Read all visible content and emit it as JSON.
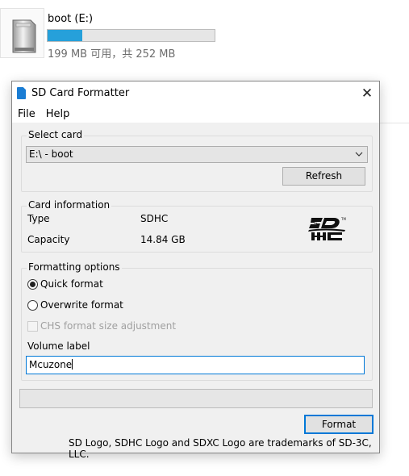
{
  "drive": {
    "name": "boot (E:)",
    "size_text": "199 MB 可用，共 252 MB",
    "used_fraction": 0.21,
    "icon": "drive-icon",
    "bar_color": "#26a0da"
  },
  "window": {
    "title": "SD Card Formatter",
    "close_glyph": "✕",
    "accent": "#0078d7"
  },
  "menu": [
    "File",
    "Help"
  ],
  "select_card": {
    "title": "Select card",
    "selected": "E:\\ - boot",
    "refresh_label": "Refresh"
  },
  "card_info": {
    "title": "Card information",
    "type_label": "Type",
    "type_value": "SDHC",
    "capacity_label": "Capacity",
    "capacity_value": "14.84 GB",
    "logo": "sdhc-logo"
  },
  "formatting": {
    "title": "Formatting options",
    "quick_label": "Quick format",
    "overwrite_label": "Overwrite format",
    "chs_label": "CHS format size adjustment",
    "selected_option": "quick",
    "volume_label_title": "Volume label",
    "volume_label_value": "Mcuzone"
  },
  "format_button": "Format",
  "footer": "SD Logo, SDHC Logo and SDXC Logo are trademarks of SD-3C, LLC."
}
